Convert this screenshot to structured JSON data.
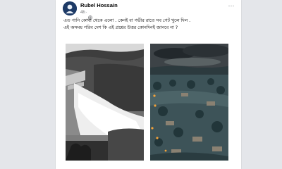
{
  "post": {
    "author": "Rubel Hossain",
    "time": "4h",
    "visibility_icon": "globe-icon",
    "verified_icon": "verified-badge-icon",
    "more_icon": "more-options-icon",
    "text_line_1": "এত পানি কোথা থেকে এলো . কেনই বা গভীর রাতে সব গেট খুলে দিল .",
    "text_line_2": "এই অসময় গরিব দেশ কি এই প্রশ্নের উত্তর কোনদিনই জানবে না ?"
  },
  "photos": [
    {
      "name": "dam-spillway-photo",
      "style": "black-and-white"
    },
    {
      "name": "flooded-town-photo",
      "style": "color-night"
    }
  ],
  "colors": {
    "page_bg": "#e4e6ea",
    "card_bg": "#ffffff",
    "meta_text": "#65676b",
    "brand": "#1877f2"
  }
}
